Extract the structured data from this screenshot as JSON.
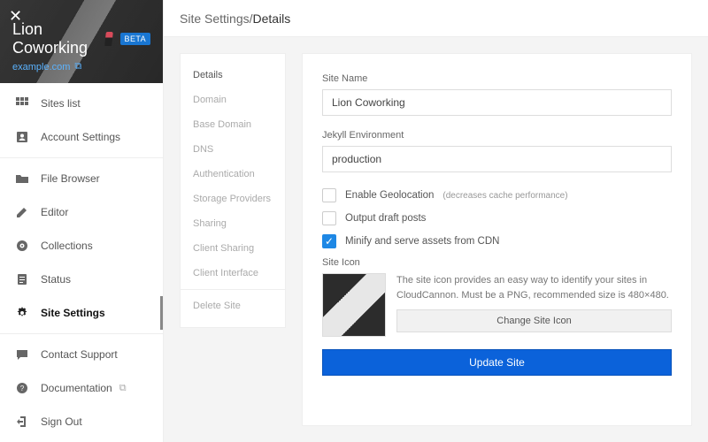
{
  "hero": {
    "site_name": "Lion Coworking",
    "beta_label": "BETA",
    "domain": "example.com"
  },
  "breadcrumb": {
    "root": "Site Settings",
    "sep": " / ",
    "current": "Details"
  },
  "nav": {
    "sites_list": "Sites list",
    "account_settings": "Account Settings",
    "file_browser": "File Browser",
    "editor": "Editor",
    "collections": "Collections",
    "status": "Status",
    "site_settings": "Site Settings",
    "contact_support": "Contact Support",
    "documentation": "Documentation",
    "sign_out": "Sign Out"
  },
  "settings_nav": [
    "Details",
    "Domain",
    "Base Domain",
    "DNS",
    "Authentication",
    "Storage Providers",
    "Sharing",
    "Client Sharing",
    "Client Interface"
  ],
  "settings_nav_danger": "Delete Site",
  "form": {
    "site_name_label": "Site Name",
    "site_name_value": "Lion Coworking",
    "env_label": "Jekyll Environment",
    "env_value": "production",
    "geo_label": "Enable Geolocation",
    "geo_hint": "(decreases cache performance)",
    "drafts_label": "Output draft posts",
    "minify_label": "Minify and serve assets from CDN",
    "icon_label": "Site Icon",
    "icon_desc": "The site icon provides an easy way to identify your sites in CloudCannon. Must be a PNG, recommended size is 480×480.",
    "change_icon_btn": "Change Site Icon",
    "submit_btn": "Update Site"
  }
}
